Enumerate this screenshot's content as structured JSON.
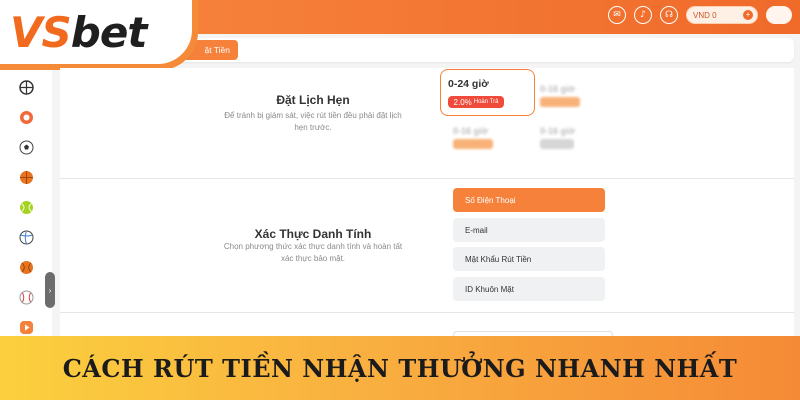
{
  "brand": {
    "logo_part1": "VS",
    "logo_part2": "bet"
  },
  "header": {
    "balance_label": "VND 0",
    "balance_add_symbol": "+",
    "icons": [
      "message-icon",
      "bell-icon",
      "headset-icon"
    ]
  },
  "tabs": {
    "active_label": "ặt Tiền"
  },
  "sidebar": {
    "icons": [
      "sports-all-icon",
      "poker-chip-icon",
      "soccer-ball-icon",
      "basketball-icon",
      "tennis-ball-icon",
      "volleyball-icon",
      "basketball-icon",
      "baseball-icon",
      "video-play-icon"
    ],
    "toggle_symbol": "›"
  },
  "appointment": {
    "title": "Đặt Lịch Hẹn",
    "description_line1": "Để tránh bị giám sát, việc rút tiền đều phải đặt lịch",
    "description_line2": "hẹn trước.",
    "active_option": {
      "time": "0-24 giờ",
      "rebate_value": "2.0%",
      "rebate_label": "Hoàn Trả"
    },
    "blurred_options": [
      "0-16 giờ",
      "0-16 giờ",
      "0-16 giờ"
    ]
  },
  "identity": {
    "title": "Xác Thực Danh Tính",
    "description_line1": "Chọn phương thức xác thực danh tính và hoàn tất",
    "description_line2": "xác thực bảo mật.",
    "methods": [
      "Số Điện Thoại",
      "E-mail",
      "Mật Khẩu Rút Tiền",
      "ID Khuôn Mặt"
    ],
    "active_index": 0
  },
  "banner": {
    "text": "CÁCH RÚT TIỀN NHẬN THƯỞNG NHANH NHẤT"
  },
  "colors": {
    "accent": "#f5813b",
    "banner_start": "#fbd03e",
    "banner_end": "#f58a36",
    "badge_red": "#ef4a3a"
  }
}
